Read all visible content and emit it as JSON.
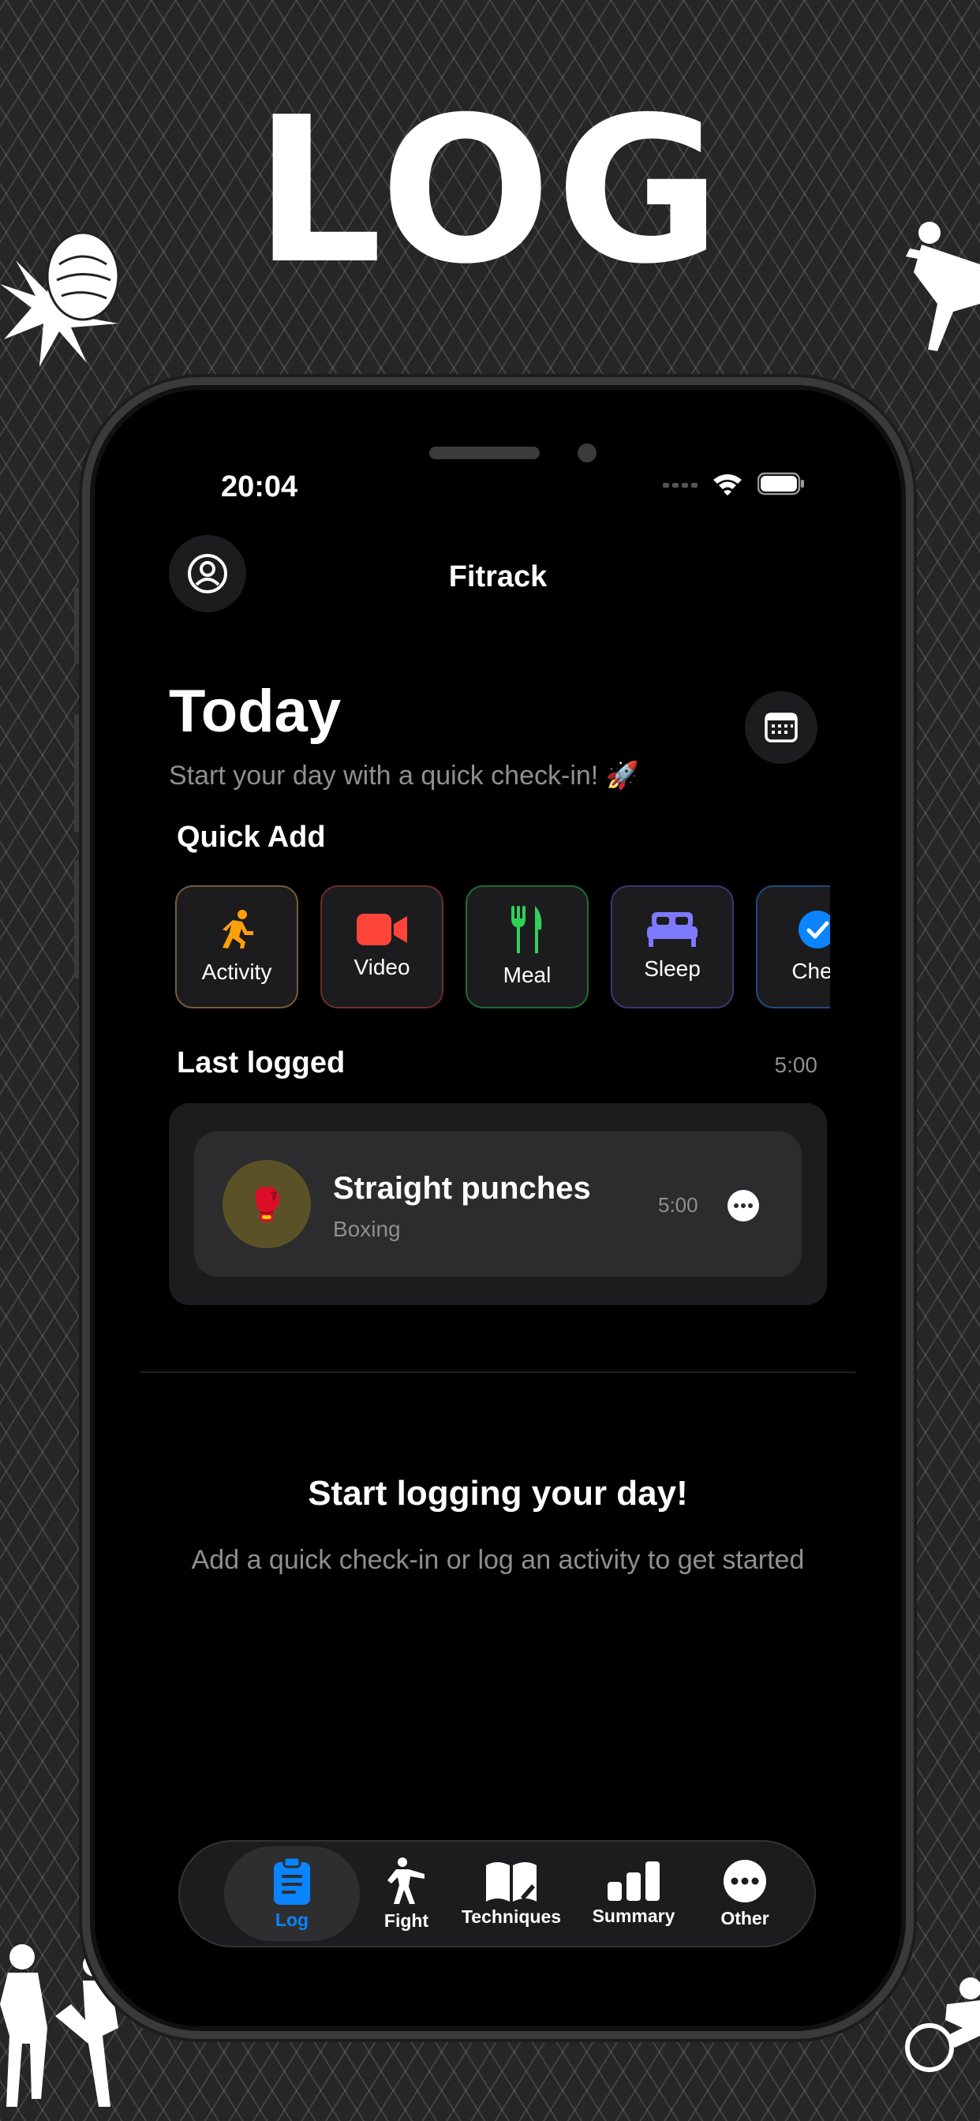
{
  "headline": "LOG",
  "status_bar": {
    "time": "20:04"
  },
  "header": {
    "title": "Fitrack"
  },
  "today": {
    "title": "Today",
    "subtitle": "Start your day with a quick check-in! 🚀"
  },
  "quick_add": {
    "title": "Quick Add",
    "items": [
      {
        "label": "Activity",
        "icon": "running-icon",
        "color": "#ff9f0a"
      },
      {
        "label": "Video",
        "icon": "video-camera-icon",
        "color": "#ff453a"
      },
      {
        "label": "Meal",
        "icon": "fork-knife-icon",
        "color": "#30d158"
      },
      {
        "label": "Sleep",
        "icon": "bed-icon",
        "color": "#7d7aff"
      },
      {
        "label": "Chec",
        "icon": "checkmark-circle-icon",
        "color": "#0a84ff"
      }
    ]
  },
  "last_logged": {
    "title": "Last logged",
    "time": "5:00",
    "entry": {
      "title": "Straight punches",
      "category": "Boxing",
      "duration": "5:00",
      "icon": "🥊"
    }
  },
  "empty_state": {
    "title": "Start logging your day!",
    "subtitle": "Add a quick check-in or log an activity to get started"
  },
  "tabs": [
    {
      "label": "Log",
      "icon": "clipboard-icon",
      "active": true
    },
    {
      "label": "Fight",
      "icon": "fighter-icon",
      "active": false
    },
    {
      "label": "Techniques",
      "icon": "book-icon",
      "active": false
    },
    {
      "label": "Summary",
      "icon": "bar-chart-icon",
      "active": false
    },
    {
      "label": "Other",
      "icon": "ellipsis-circle-icon",
      "active": false
    }
  ],
  "colors": {
    "accent": "#0a84ff",
    "background": "#000000",
    "card": "#1c1c1e"
  }
}
